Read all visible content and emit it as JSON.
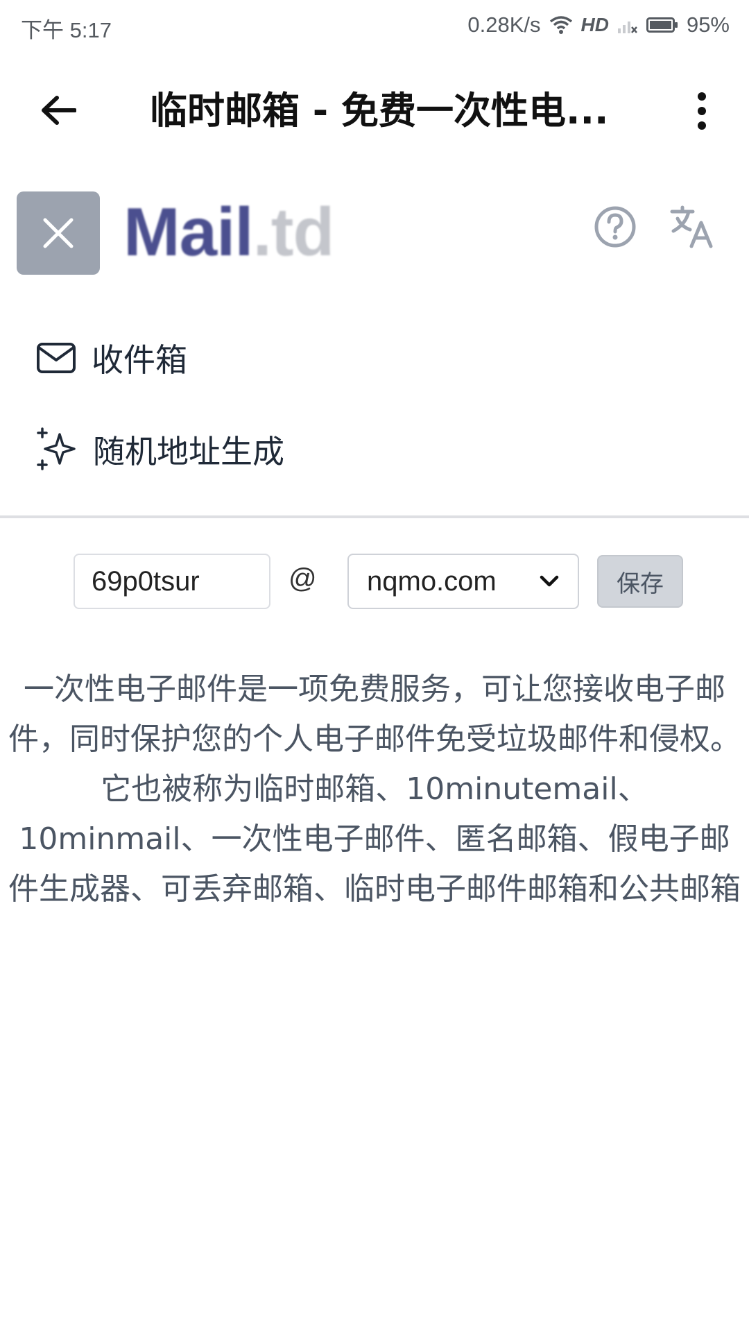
{
  "status_bar": {
    "time": "下午 5:17",
    "network_speed": "0.28K/s",
    "hd_label": "HD",
    "battery": "95%"
  },
  "title_bar": {
    "title": "临时邮箱 - 免费一次性电..."
  },
  "site_header": {
    "logo_main": "Mail",
    "logo_tld": ".td"
  },
  "nav": {
    "inbox_label": "收件箱",
    "random_label": "随机地址生成"
  },
  "address_form": {
    "local_part": "69p0tsur",
    "at": "@",
    "domain": "nqmo.com",
    "save_label": "保存"
  },
  "description": "一次性电子邮件是一项免费服务，可让您接收电子邮件，同时保护您的个人电子邮件免受垃圾邮件和侵权。它也被称为临时邮箱、10minutemail、10minmail、一次性电子邮件、匿名邮箱、假电子邮件生成器、可丢弃邮箱、临时电子邮件邮箱和公共邮箱",
  "colors": {
    "logo": "#4b4f8f",
    "close_button_bg": "#9ca3af",
    "save_button_bg": "#d1d5db"
  },
  "icons": {
    "back": "arrow-left-icon",
    "more": "more-vertical-icon",
    "close": "close-icon",
    "help": "help-circle-icon",
    "translate": "translate-icon",
    "inbox": "envelope-icon",
    "random": "sparkles-icon",
    "dropdown": "chevron-down-icon"
  }
}
